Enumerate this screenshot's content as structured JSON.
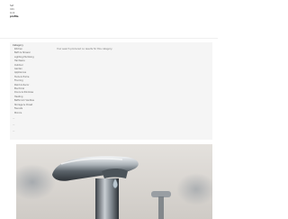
{
  "header": {
    "lines": [
      "Sat",
      "Info",
      "Link",
      "profile"
    ]
  },
  "sidebar": {
    "title": "Category",
    "items": [
      "Kitchen",
      "Bath & Shower",
      "Lighting Plumbing",
      "Hardware",
      "Outdoor",
      "Garden",
      "Appliances",
      "Tools & Home",
      "Flooring",
      "Paint & Decor",
      "Electrical",
      "Doors & Windows",
      "Heating",
      "Bathroom Vanities",
      "Storage & Closet",
      "Faucets",
      "Mirrors"
    ],
    "dashes": [
      "—",
      "—",
      "—"
    ]
  },
  "main": {
    "message": "Your search produced no results for this category."
  },
  "hero": {
    "subject": "chrome faucet with water drop"
  },
  "colors": {
    "panel_bg": "#f5f5f5",
    "page_bg": "#ffffff"
  }
}
